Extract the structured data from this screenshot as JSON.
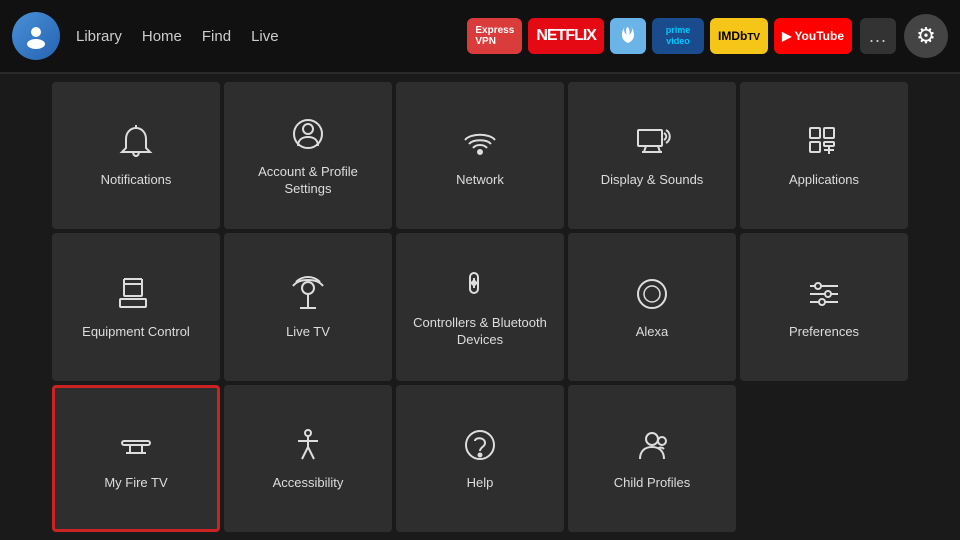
{
  "navbar": {
    "nav_links": [
      {
        "label": "Library",
        "id": "library"
      },
      {
        "label": "Home",
        "id": "home"
      },
      {
        "label": "Find",
        "id": "find"
      },
      {
        "label": "Live",
        "id": "live"
      }
    ],
    "app_shortcuts": [
      {
        "id": "expressvpn",
        "label": "ExpressVPN",
        "bg": "#da3c3c",
        "color": "#fff"
      },
      {
        "id": "netflix",
        "label": "NETFLIX",
        "bg": "#e50914",
        "color": "#fff"
      },
      {
        "id": "fire",
        "label": "🔥",
        "bg": "#6ab4e8",
        "color": "#fff"
      },
      {
        "id": "prime",
        "label": "prime video",
        "bg": "#1a4b8c",
        "color": "#00c8ff"
      },
      {
        "id": "imdb",
        "label": "IMDbTV",
        "bg": "#f5c518",
        "color": "#000"
      },
      {
        "id": "youtube",
        "label": "▶ YouTube",
        "bg": "#ff0000",
        "color": "#fff"
      }
    ],
    "more_label": "...",
    "settings_icon": "⚙"
  },
  "grid": {
    "items": [
      {
        "id": "notifications",
        "label": "Notifications",
        "icon": "bell",
        "selected": false
      },
      {
        "id": "account-profile",
        "label": "Account & Profile Settings",
        "icon": "person-circle",
        "selected": false
      },
      {
        "id": "network",
        "label": "Network",
        "icon": "wifi",
        "selected": false
      },
      {
        "id": "display-sounds",
        "label": "Display & Sounds",
        "icon": "display-sound",
        "selected": false
      },
      {
        "id": "applications",
        "label": "Applications",
        "icon": "apps",
        "selected": false
      },
      {
        "id": "equipment-control",
        "label": "Equipment Control",
        "icon": "tv-remote",
        "selected": false
      },
      {
        "id": "live-tv",
        "label": "Live TV",
        "icon": "antenna",
        "selected": false
      },
      {
        "id": "controllers-bluetooth",
        "label": "Controllers & Bluetooth Devices",
        "icon": "controller",
        "selected": false
      },
      {
        "id": "alexa",
        "label": "Alexa",
        "icon": "alexa",
        "selected": false
      },
      {
        "id": "preferences",
        "label": "Preferences",
        "icon": "sliders",
        "selected": false
      },
      {
        "id": "my-fire-tv",
        "label": "My Fire TV",
        "icon": "firetv",
        "selected": true
      },
      {
        "id": "accessibility",
        "label": "Accessibility",
        "icon": "accessibility",
        "selected": false
      },
      {
        "id": "help",
        "label": "Help",
        "icon": "help-circle",
        "selected": false
      },
      {
        "id": "child-profiles",
        "label": "Child Profiles",
        "icon": "child-profile",
        "selected": false
      }
    ]
  }
}
